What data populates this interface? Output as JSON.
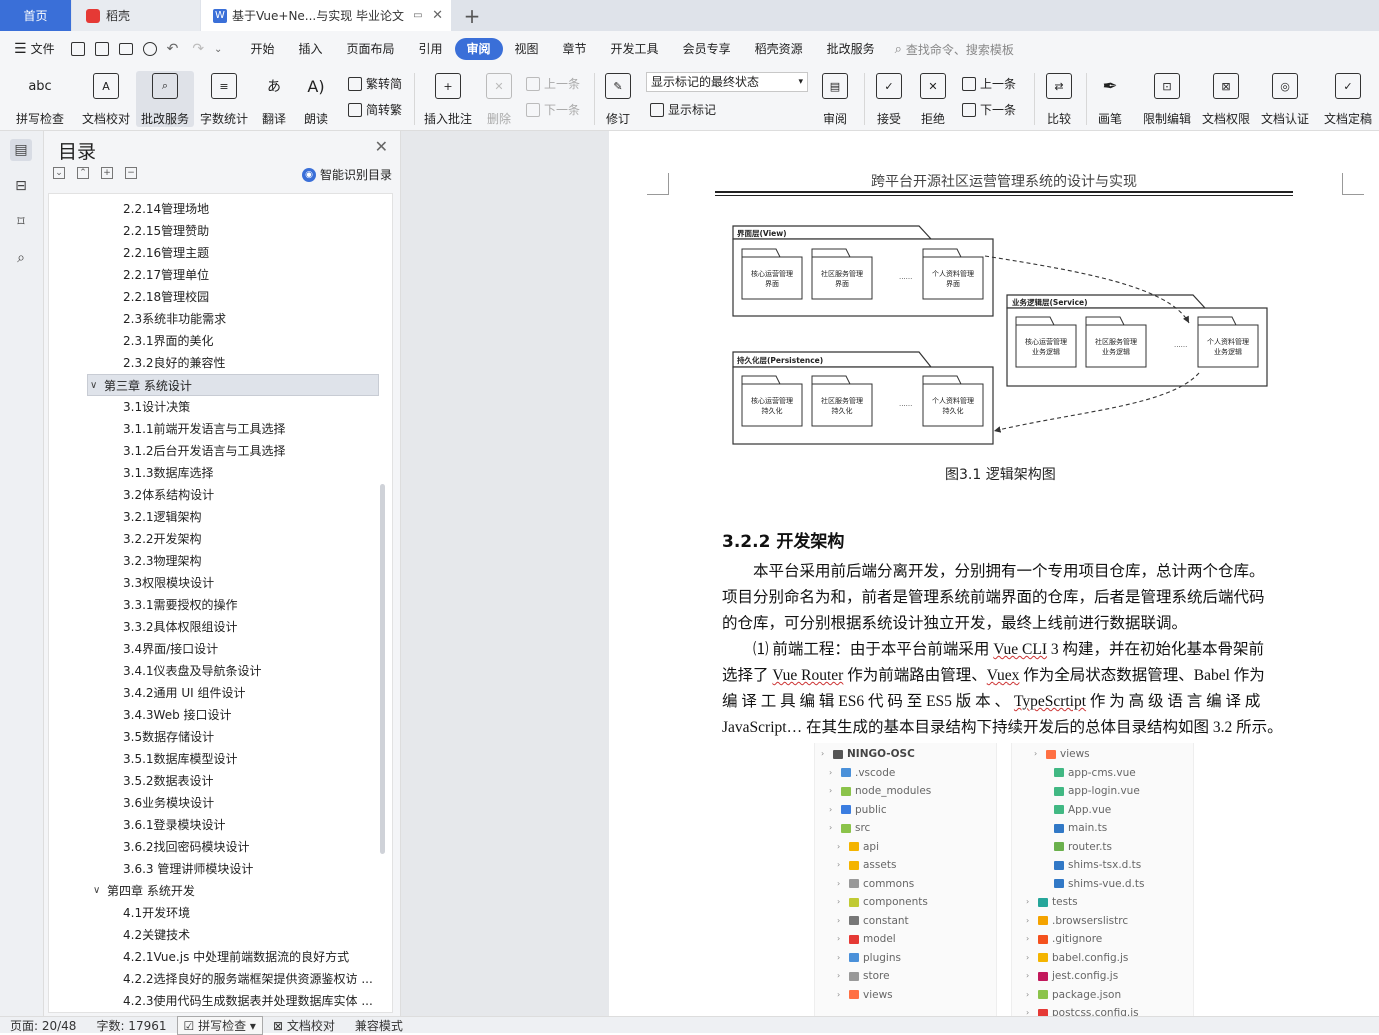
{
  "tabs": {
    "home": "首页",
    "daoke": "稻壳",
    "doc": "基于Vue+Ne...与实现 毕业论文"
  },
  "menu": [
    "文件",
    "开始",
    "插入",
    "页面布局",
    "引用",
    "审阅",
    "视图",
    "章节",
    "开发工具",
    "会员专享",
    "稻壳资源",
    "批改服务"
  ],
  "menu_active": "审阅",
  "search_placeholder": "查找命令、搜索模板",
  "ribbon": {
    "spell": "拼写检查",
    "proof": "文档校对",
    "review_service": "批改服务",
    "word_count": "字数统计",
    "translate": "翻译",
    "read": "朗读",
    "trad": "繁转简",
    "simp": "简转繁",
    "insert_comment": "插入批注",
    "delete": "删除",
    "prev": "上一条",
    "next": "下一条",
    "track": "修订",
    "markup_state": "显示标记的最终状态",
    "show_markup": "显示标记",
    "review": "审阅",
    "accept": "接受",
    "reject": "拒绝",
    "prev2": "上一条",
    "next2": "下一条",
    "compare": "比较",
    "pen": "画笔",
    "restrict": "限制编辑",
    "permission": "文档权限",
    "certify": "文档认证",
    "finalize": "文档定稿"
  },
  "toc": {
    "title": "目录",
    "smart": "智能识别目录",
    "items": [
      {
        "t": "2.2.14管理场地",
        "lvl": 2
      },
      {
        "t": "2.2.15管理赞助",
        "lvl": 2
      },
      {
        "t": "2.2.16管理主题",
        "lvl": 2
      },
      {
        "t": "2.2.17管理单位",
        "lvl": 2
      },
      {
        "t": "2.2.18管理校园",
        "lvl": 2
      },
      {
        "t": "2.3系统非功能需求",
        "lvl": 2
      },
      {
        "t": "2.3.1界面的美化",
        "lvl": 2
      },
      {
        "t": "2.3.2良好的兼容性",
        "lvl": 2
      },
      {
        "t": "第三章  系统设计",
        "lvl": 1
      },
      {
        "t": "3.1设计决策",
        "lvl": 2
      },
      {
        "t": "3.1.1前端开发语言与工具选择",
        "lvl": 2
      },
      {
        "t": "3.1.2后台开发语言与工具选择",
        "lvl": 2
      },
      {
        "t": "3.1.3数据库选择",
        "lvl": 2
      },
      {
        "t": "3.2体系结构设计",
        "lvl": 2
      },
      {
        "t": "3.2.1逻辑架构",
        "lvl": 2
      },
      {
        "t": "3.2.2开发架构",
        "lvl": 2
      },
      {
        "t": "3.2.3物理架构",
        "lvl": 2
      },
      {
        "t": "3.3权限模块设计",
        "lvl": 2
      },
      {
        "t": "3.3.1需要授权的操作",
        "lvl": 2
      },
      {
        "t": "3.3.2具体权限组设计",
        "lvl": 2
      },
      {
        "t": "3.4界面/接口设计",
        "lvl": 2
      },
      {
        "t": "3.4.1仪表盘及导航条设计",
        "lvl": 2
      },
      {
        "t": "3.4.2通用 UI 组件设计",
        "lvl": 2
      },
      {
        "t": "3.4.3Web 接口设计",
        "lvl": 2
      },
      {
        "t": "3.5数据存储设计",
        "lvl": 2
      },
      {
        "t": "3.5.1数据库模型设计",
        "lvl": 2
      },
      {
        "t": "3.5.2数据表设计",
        "lvl": 2
      },
      {
        "t": "3.6业务模块设计",
        "lvl": 2
      },
      {
        "t": "3.6.1登录模块设计",
        "lvl": 2
      },
      {
        "t": "3.6.2找回密码模块设计",
        "lvl": 2
      },
      {
        "t": "3.6.3 管理讲师模块设计",
        "lvl": 2
      },
      {
        "t": "第四章  系统开发",
        "lvl": 1
      },
      {
        "t": "4.1开发环境",
        "lvl": 2
      },
      {
        "t": "4.2关键技术",
        "lvl": 2
      },
      {
        "t": "4.2.1Vue.js 中处理前端数据流的良好方式",
        "lvl": 2
      },
      {
        "t": "4.2.2选择良好的服务端框架提供资源鉴权访 ...",
        "lvl": 2
      },
      {
        "t": "4.2.3使用代码生成数据表并处理数据库实体 ...",
        "lvl": 2
      }
    ]
  },
  "doc": {
    "header": "跨平台开源社区运营管理系统的设计与实现",
    "diagram": {
      "view_layer": "界面层(View)",
      "service_layer": "业务逻辑层(Service)",
      "persist_layer": "持久化层(Persistence)",
      "view_boxes": [
        "核心运营管理\n界面",
        "社区服务管理\n界面",
        "个人资料管理\n界面"
      ],
      "service_boxes": [
        "核心运营管理\n业务逻辑",
        "社区服务管理\n业务逻辑",
        "个人资料管理\n业务逻辑"
      ],
      "persist_boxes": [
        "核心运营管理\n持久化",
        "社区服务管理\n持久化",
        "个人资料管理\n持久化"
      ],
      "ellipsis": "......"
    },
    "fig_caption": "图3.1    逻辑架构图",
    "heading": "3.2.2 开发架构",
    "p1": [
      "　　本平台采用前后端分离开发，分别拥有一个专用项目仓库，总计两个仓库。",
      "项目分别命名为和，前者是管理系统前端界面的仓库，后者是管理系统后端代码",
      "的仓库，可分别根据系统设计独立开发，最终上线前进行数据联调。"
    ],
    "p2": {
      "l1a": "　　⑴   前端工程：由于本平台前端采用 ",
      "l1u": "Vue CLI",
      "l1b": " 3 构建，并在初始化基本骨架前",
      "l2a": "选择了 ",
      "l2u1": "Vue Router",
      "l2b": " 作为前端路由管理、",
      "l2u2": "Vuex",
      "l2c": " 作为全局状态数据管理、Babel 作为",
      "l3a": "编 译 工 具 编 辑  ES6  代 码 至  ES5  版 本 、 ",
      "l3u": "TypeScrtipt",
      "l3b": "  作 为 高 级 语 言 编 译 成",
      "l4": "JavaScript… 在其生成的基本目录结构下持续开发后的总体目录结构如图 3.2 所示。"
    },
    "tree_left": [
      {
        "n": "NINGO-OSC",
        "c": "#555",
        "lvl": 0
      },
      {
        "n": ".vscode",
        "c": "#4a90d9",
        "lvl": 1
      },
      {
        "n": "node_modules",
        "c": "#8bc34a",
        "lvl": 1
      },
      {
        "n": "public",
        "c": "#3b7de0",
        "lvl": 1
      },
      {
        "n": "src",
        "c": "#8bc34a",
        "lvl": 1
      },
      {
        "n": "api",
        "c": "#f4b400",
        "lvl": 2
      },
      {
        "n": "assets",
        "c": "#f4b400",
        "lvl": 2
      },
      {
        "n": "commons",
        "c": "#999",
        "lvl": 2
      },
      {
        "n": "components",
        "c": "#c0ca33",
        "lvl": 2
      },
      {
        "n": "constant",
        "c": "#777",
        "lvl": 2
      },
      {
        "n": "model",
        "c": "#e53935",
        "lvl": 2
      },
      {
        "n": "plugins",
        "c": "#4a90d9",
        "lvl": 2
      },
      {
        "n": "store",
        "c": "#999",
        "lvl": 2
      },
      {
        "n": "views",
        "c": "#ff7043",
        "lvl": 2
      }
    ],
    "tree_right": [
      {
        "n": "views",
        "c": "#ff7043",
        "lvl": 2
      },
      {
        "n": "app-cms.vue",
        "c": "#41b883",
        "lvl": 3
      },
      {
        "n": "app-login.vue",
        "c": "#41b883",
        "lvl": 3
      },
      {
        "n": "App.vue",
        "c": "#41b883",
        "lvl": 3
      },
      {
        "n": "main.ts",
        "c": "#3178c6",
        "lvl": 3
      },
      {
        "n": "router.ts",
        "c": "#6ab04c",
        "lvl": 3
      },
      {
        "n": "shims-tsx.d.ts",
        "c": "#3178c6",
        "lvl": 3
      },
      {
        "n": "shims-vue.d.ts",
        "c": "#3178c6",
        "lvl": 3
      },
      {
        "n": "tests",
        "c": "#26a69a",
        "lvl": 1
      },
      {
        "n": ".browserslistrc",
        "c": "#f4a300",
        "lvl": 1
      },
      {
        "n": ".gitignore",
        "c": "#f4511e",
        "lvl": 1
      },
      {
        "n": "babel.config.js",
        "c": "#f4b400",
        "lvl": 1
      },
      {
        "n": "jest.config.js",
        "c": "#c2185b",
        "lvl": 1
      },
      {
        "n": "package.json",
        "c": "#8bc34a",
        "lvl": 1
      },
      {
        "n": "postcss.config.js",
        "c": "#e53935",
        "lvl": 1
      }
    ]
  },
  "status": {
    "page": "页面: 20/48",
    "words": "字数: 17961",
    "spell": "拼写检查",
    "proof": "文档校对",
    "compat": "兼容模式"
  }
}
